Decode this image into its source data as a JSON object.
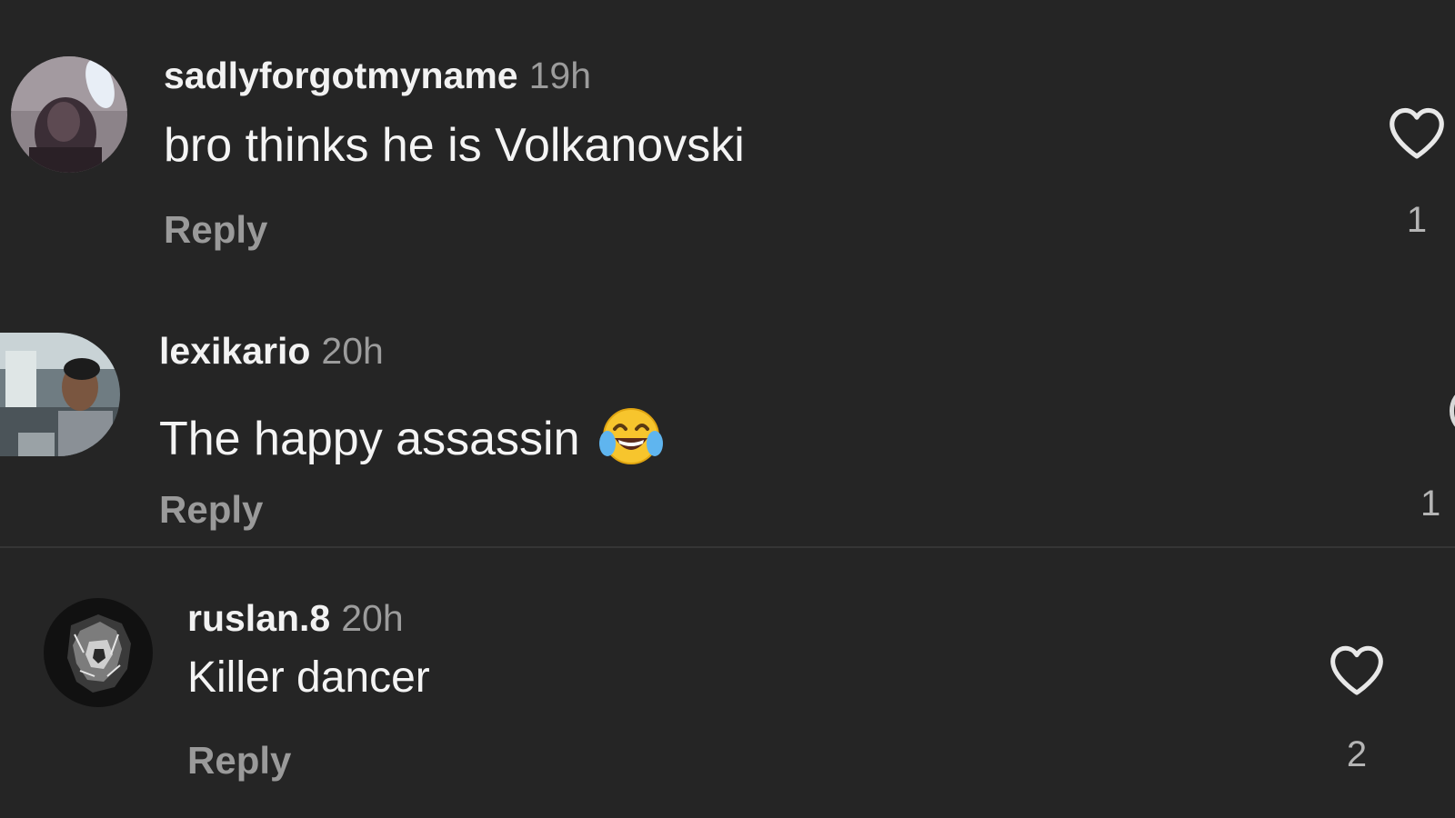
{
  "comments": [
    {
      "username": "sadlyforgotmyname",
      "time": "19h",
      "text": "bro thinks he is Volkanovski",
      "reply_label": "Reply",
      "likes": "1"
    },
    {
      "username": "lexikario",
      "time": "20h",
      "text": "The happy assassin",
      "emoji": "face-with-tears-of-joy",
      "reply_label": "Reply",
      "likes": "1"
    },
    {
      "username": "ruslan.8",
      "time": "20h",
      "text": "Killer dancer",
      "reply_label": "Reply",
      "likes": "2"
    }
  ],
  "colors": {
    "background": "#252525",
    "primary_text": "#f2f2f2",
    "secondary_text": "#9a9a9a",
    "divider": "#353535"
  }
}
